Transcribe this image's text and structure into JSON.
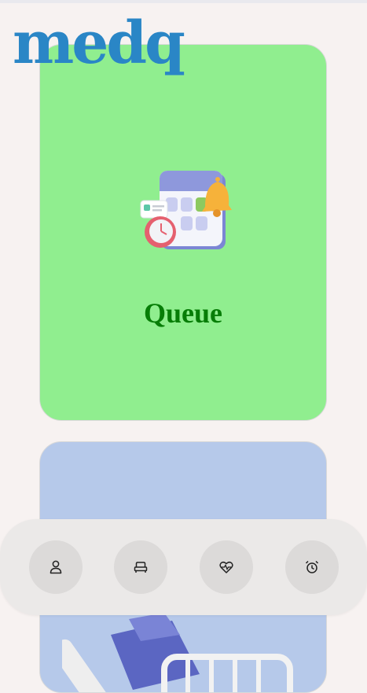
{
  "app": {
    "logo_text": "medq"
  },
  "cards": [
    {
      "title": "Queue",
      "icon": "calendar-alarm-bell-illustration",
      "color": "#90ee8f"
    },
    {
      "title": "",
      "icon": "hospital-bed-illustration",
      "color": "#b6c9ea"
    }
  ],
  "bottom_nav": {
    "items": [
      {
        "icon": "person-icon"
      },
      {
        "icon": "bed-icon"
      },
      {
        "icon": "heart-pulse-icon"
      },
      {
        "icon": "alarm-clock-icon"
      }
    ]
  },
  "colors": {
    "brand": "#2a86c6",
    "queue_title": "#077d07",
    "background": "#f7f2f1"
  }
}
